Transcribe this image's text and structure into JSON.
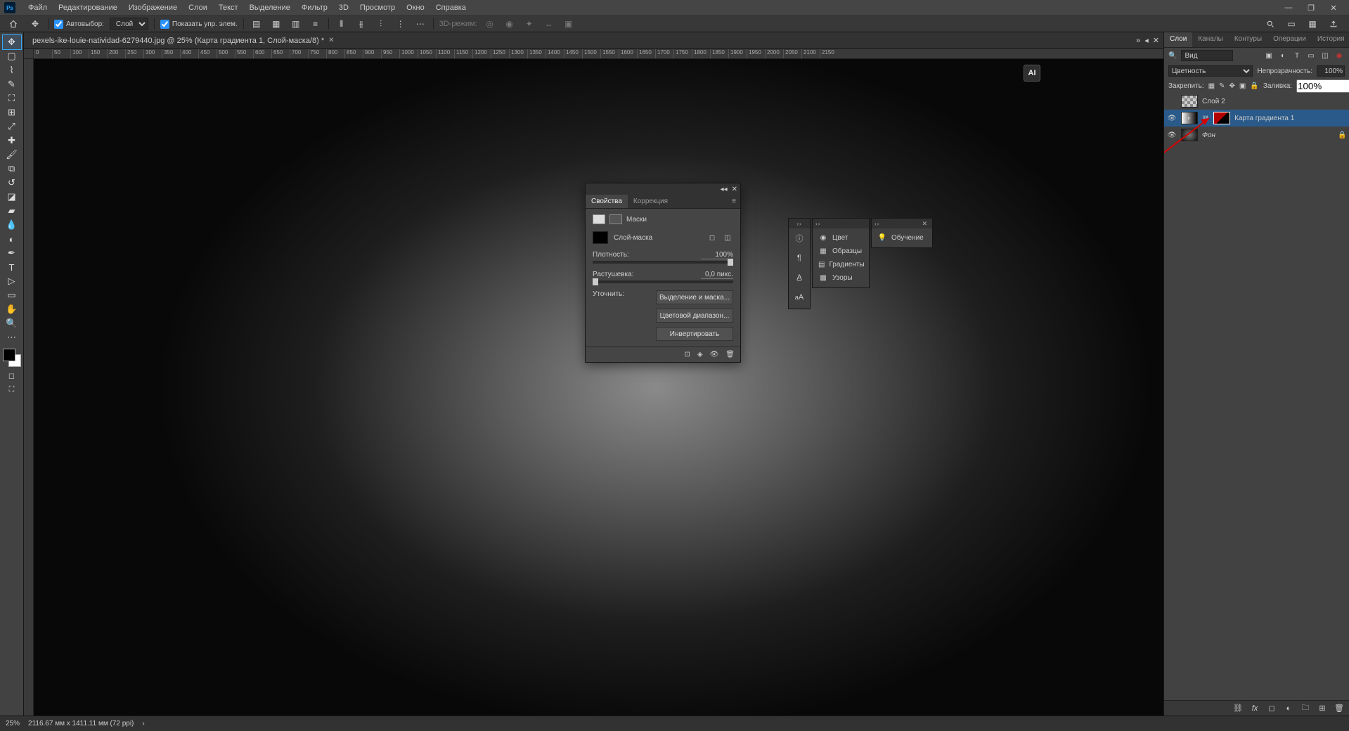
{
  "menu": [
    "Файл",
    "Редактирование",
    "Изображение",
    "Слои",
    "Текст",
    "Выделение",
    "Фильтр",
    "3D",
    "Просмотр",
    "Окно",
    "Справка"
  ],
  "options": {
    "auto_select_label": "Автовыбор:",
    "auto_select_target": "Слой",
    "show_transform_label": "Показать упр. элем.",
    "mode3d_label": "3D-режим:"
  },
  "document": {
    "tab_title": "pexels-ike-louie-natividad-6279440.jpg @ 25% (Карта градиента 1, Слой-маска/8) *",
    "zoom": "25%",
    "dimensions": "2116.67 мм x 1411.11 мм (72 ppi)"
  },
  "ruler": [
    "0",
    "50",
    "100",
    "150",
    "200",
    "250",
    "300",
    "350",
    "400",
    "450",
    "500",
    "550",
    "600",
    "650",
    "700",
    "750",
    "800",
    "850",
    "900",
    "950",
    "1000",
    "1050",
    "1100",
    "1150",
    "1200",
    "1250",
    "1300",
    "1350",
    "1400",
    "1450",
    "1500",
    "1550",
    "1600",
    "1650",
    "1700",
    "1750",
    "1800",
    "1850",
    "1900",
    "1950",
    "2000",
    "2050",
    "2100",
    "2150"
  ],
  "ai_chip": "AI",
  "layers_panel": {
    "tabs": [
      "Слои",
      "Каналы",
      "Контуры",
      "Операции",
      "История"
    ],
    "filter_label": "Вид",
    "blend_label": "Цветность",
    "opacity_label": "Непрозрачность:",
    "opacity_value": "100%",
    "lock_label": "Закрепить:",
    "fill_label": "Заливка:",
    "fill_value": "100%",
    "layers": [
      {
        "name": "Слой 2",
        "visible": false,
        "kind": "raster"
      },
      {
        "name": "Карта градиента 1",
        "visible": true,
        "kind": "adjust-maskред",
        "selected": true
      },
      {
        "name": "Фон",
        "visible": true,
        "kind": "bg",
        "locked": true
      }
    ]
  },
  "properties_panel": {
    "tabs": [
      "Свойства",
      "Коррекция"
    ],
    "section_label": "Маски",
    "mask_type_label": "Слой-маска",
    "density_label": "Плотность:",
    "density_value": "100%",
    "feather_label": "Растушевка:",
    "feather_value": "0,0 пикс.",
    "refine_label": "Уточнить:",
    "buttons": [
      "Выделение и маска...",
      "Цветовой диапазон...",
      "Инвертировать"
    ]
  },
  "color_panel": {
    "items": [
      "Цвет",
      "Образцы",
      "Градиенты",
      "Узоры"
    ]
  },
  "learn_panel": {
    "label": "Обучение"
  }
}
